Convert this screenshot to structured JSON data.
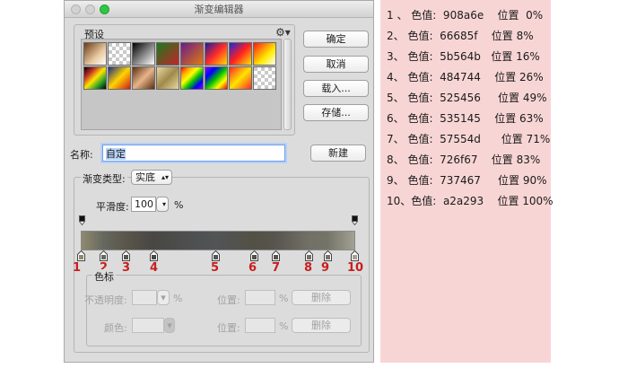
{
  "dialog": {
    "title": "渐变编辑器",
    "presets": {
      "label": "预设",
      "gear_icon": "gear-icon"
    },
    "buttons": {
      "ok": "确定",
      "cancel": "取消",
      "load": "载入...",
      "save": "存储...",
      "new": "新建"
    },
    "name": {
      "label": "名称:",
      "value": "自定"
    },
    "gradient_type": {
      "label": "渐变类型:",
      "value": "实底"
    },
    "smoothness": {
      "label": "平滑度:",
      "value": "100",
      "unit": "%"
    },
    "stop_numbers": [
      "1",
      "2",
      "3",
      "4",
      "5",
      "6",
      "7",
      "8",
      "9",
      "10"
    ],
    "stops_section": {
      "title": "色标",
      "opacity_label": "不透明度:",
      "opacity_unit": "%",
      "color_label": "颜色:",
      "location_label_1": "位置:",
      "location_unit_1": "%",
      "location_label_2": "位置:",
      "location_unit_2": "%",
      "delete_1": "删除",
      "delete_2": "删除"
    }
  },
  "color_stops": [
    {
      "index": "1",
      "color": "908a6e",
      "location": "0%",
      "text": "1 、 色值:  908a6e    位置  0%"
    },
    {
      "index": "2",
      "color": "66685f",
      "location": "8%",
      "text": "2、 色值:  66685f    位置 8%"
    },
    {
      "index": "3",
      "color": "5b564b",
      "location": "16%",
      "text": "3、 色值:  5b564b   位置 16%"
    },
    {
      "index": "4",
      "color": "484744",
      "location": "26%",
      "text": "4、 色值:  484744    位置 26%"
    },
    {
      "index": "5",
      "color": "525456",
      "location": "49%",
      "text": "5、 色值:  525456     位置 49%"
    },
    {
      "index": "6",
      "color": "535145",
      "location": "63%",
      "text": "6、 色值:  535145    位置 63%"
    },
    {
      "index": "7",
      "color": "57554d",
      "location": "71%",
      "text": "7、 色值:  57554d      位置 71%"
    },
    {
      "index": "8",
      "color": "726f67",
      "location": "83%",
      "text": "8、 色值:  726f67    位置 83%"
    },
    {
      "index": "9",
      "color": "737467",
      "location": "90%",
      "text": "9、 色值:  737467     位置 90%"
    },
    {
      "index": "10",
      "color": "a2a293",
      "location": "100%",
      "text": "10、色值:  a2a293    位置 100%"
    }
  ],
  "colors": {
    "info_panel_bg": "#f8d5d5",
    "stop_number_color": "#c81e1e",
    "window_bg": "#dcdcdc"
  }
}
